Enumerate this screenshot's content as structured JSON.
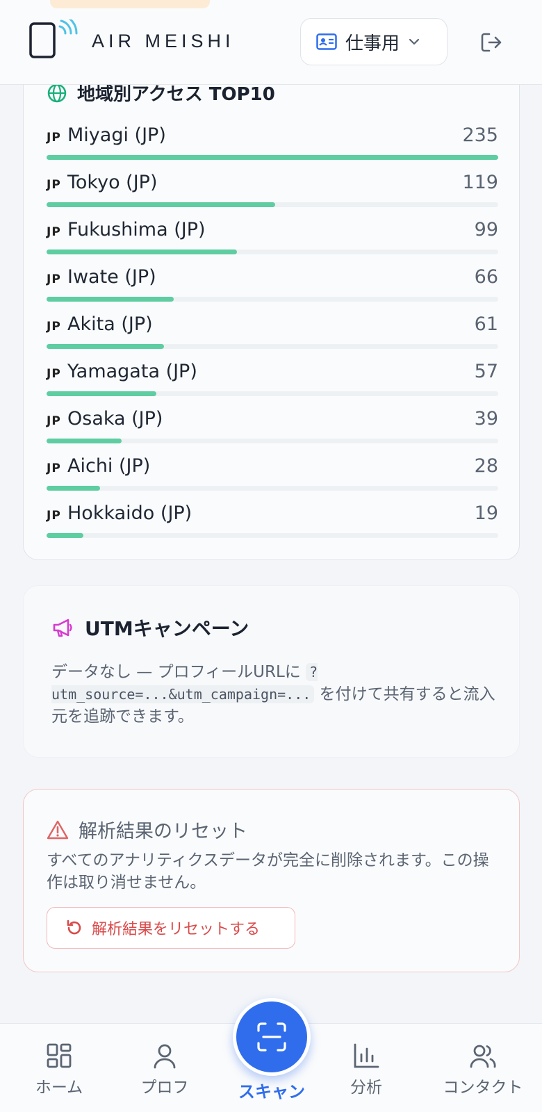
{
  "header": {
    "brand": "AIR MEISHI",
    "mode_label": "仕事用"
  },
  "region_card": {
    "title": "地域別アクセス TOP10",
    "rows": [
      {
        "code": "JP",
        "name": "Miyagi (JP)",
        "count": "235",
        "fraction": 1.0
      },
      {
        "code": "JP",
        "name": "Tokyo (JP)",
        "count": "119",
        "fraction": 0.506
      },
      {
        "code": "JP",
        "name": "Fukushima (JP)",
        "count": "99",
        "fraction": 0.421
      },
      {
        "code": "JP",
        "name": "Iwate (JP)",
        "count": "66",
        "fraction": 0.281
      },
      {
        "code": "JP",
        "name": "Akita (JP)",
        "count": "61",
        "fraction": 0.26
      },
      {
        "code": "JP",
        "name": "Yamagata (JP)",
        "count": "57",
        "fraction": 0.243
      },
      {
        "code": "JP",
        "name": "Osaka (JP)",
        "count": "39",
        "fraction": 0.166
      },
      {
        "code": "JP",
        "name": "Aichi (JP)",
        "count": "28",
        "fraction": 0.119
      },
      {
        "code": "JP",
        "name": "Hokkaido (JP)",
        "count": "19",
        "fraction": 0.081
      }
    ]
  },
  "utm_card": {
    "title": "UTMキャンペーン",
    "text_before": "データなし — プロフィールURLに",
    "code": "?utm_source=...&utm_campaign=...",
    "text_after": "を付けて共有すると流入元を追跡できます。"
  },
  "reset_card": {
    "title": "解析結果のリセット",
    "description": "すべてのアナリティクスデータが完全に削除されます。この操作は取り消せません。",
    "button_label": "解析結果をリセットする"
  },
  "bottom_nav": {
    "home": "ホーム",
    "profile": "プロフ",
    "scan": "スキャン",
    "analytics": "分析",
    "contacts": "コンタクト"
  },
  "colors": {
    "accent": "#2f6ded",
    "bar": "#5ecda2",
    "danger": "#d94a4a",
    "utm_icon": "#d63ad0"
  }
}
